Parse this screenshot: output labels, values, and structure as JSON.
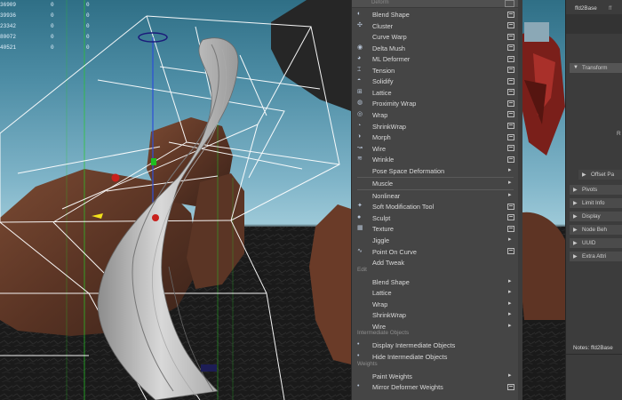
{
  "hud": [
    {
      "c1": "36909",
      "c2": "0",
      "c3": "0"
    },
    {
      "c1": "39936",
      "c2": "0",
      "c3": "0"
    },
    {
      "c1": "23342",
      "c2": "0",
      "c3": "0"
    },
    {
      "c1": "80072",
      "c2": "0",
      "c3": "0"
    },
    {
      "c1": "40521",
      "c2": "0",
      "c3": "0"
    }
  ],
  "menu": {
    "header_title": "Deform",
    "items": [
      {
        "label": "Blend Shape",
        "icon": "blend-shape-icon",
        "option": true,
        "submenu": false
      },
      {
        "label": "Cluster",
        "icon": "cluster-icon",
        "option": true,
        "submenu": false
      },
      {
        "label": "Curve Warp",
        "icon": "",
        "option": true,
        "submenu": false
      },
      {
        "label": "Delta Mush",
        "icon": "delta-mush-icon",
        "option": true,
        "submenu": false
      },
      {
        "label": "ML Deformer",
        "icon": "ml-deformer-icon",
        "option": true,
        "submenu": false
      },
      {
        "label": "Tension",
        "icon": "tension-icon",
        "option": true,
        "submenu": false
      },
      {
        "label": "Solidify",
        "icon": "solidify-icon",
        "option": true,
        "submenu": false
      },
      {
        "label": "Lattice",
        "icon": "lattice-icon",
        "option": true,
        "submenu": false
      },
      {
        "label": "Proximity Wrap",
        "icon": "proximity-wrap-icon",
        "option": true,
        "submenu": false
      },
      {
        "label": "Wrap",
        "icon": "wrap-icon",
        "option": true,
        "submenu": false
      },
      {
        "label": "ShrinkWrap",
        "icon": "shrinkwrap-icon",
        "option": true,
        "submenu": false
      },
      {
        "label": "Morph",
        "icon": "morph-icon",
        "option": true,
        "submenu": false
      },
      {
        "label": "Wire",
        "icon": "wire-icon",
        "option": true,
        "submenu": false
      },
      {
        "label": "Wrinkle",
        "icon": "wrinkle-icon",
        "option": true,
        "submenu": false
      },
      {
        "label": "Pose Space Deformation",
        "icon": "",
        "option": false,
        "submenu": true
      },
      {
        "label": "Muscle",
        "icon": "",
        "option": false,
        "submenu": true
      },
      {
        "label": "Nonlinear",
        "icon": "",
        "option": false,
        "submenu": true
      },
      {
        "label": "Soft Modification Tool",
        "icon": "soft-mod-icon",
        "option": true,
        "submenu": false
      },
      {
        "label": "Sculpt",
        "icon": "sculpt-icon",
        "option": true,
        "submenu": false
      },
      {
        "label": "Texture",
        "icon": "texture-icon",
        "option": true,
        "submenu": false
      },
      {
        "label": "Jiggle",
        "icon": "",
        "option": false,
        "submenu": true
      },
      {
        "label": "Point On Curve",
        "icon": "point-on-curve-icon",
        "option": true,
        "submenu": false
      },
      {
        "label": "Add Tweak",
        "icon": "",
        "option": false,
        "submenu": false
      }
    ],
    "edit_section": "Edit",
    "edit_items": [
      {
        "label": "Blend Shape",
        "submenu": true
      },
      {
        "label": "Lattice",
        "submenu": true
      },
      {
        "label": "Wrap",
        "submenu": true
      },
      {
        "label": "ShrinkWrap",
        "submenu": true
      },
      {
        "label": "Wire",
        "submenu": true
      }
    ],
    "intermediate_section": "Intermediate Objects",
    "intermediate_items": [
      {
        "label": "Display Intermediate Objects"
      },
      {
        "label": "Hide Intermediate Objects"
      }
    ],
    "weights_section": "Weights",
    "weights_items": [
      {
        "label": "Paint Weights",
        "submenu": true
      },
      {
        "label": "Mirror Deformer Weights",
        "option": true
      }
    ]
  },
  "attr": {
    "tab": "ffd2Base",
    "sub": "ff",
    "transform": "Transform",
    "r_label": "R",
    "sections": [
      "Offset Pa",
      "Pivots",
      "Limit Info",
      "Display",
      "Node Beh",
      "UUID",
      "Extra Attri"
    ],
    "notes": "Notes:  ffd2Base"
  },
  "colors": {
    "menu_bg": "#454545",
    "accent_red": "#c8201c",
    "manip_yellow": "#f2e11a",
    "lattice": "#ffffff",
    "grid_green": "#27c927"
  }
}
